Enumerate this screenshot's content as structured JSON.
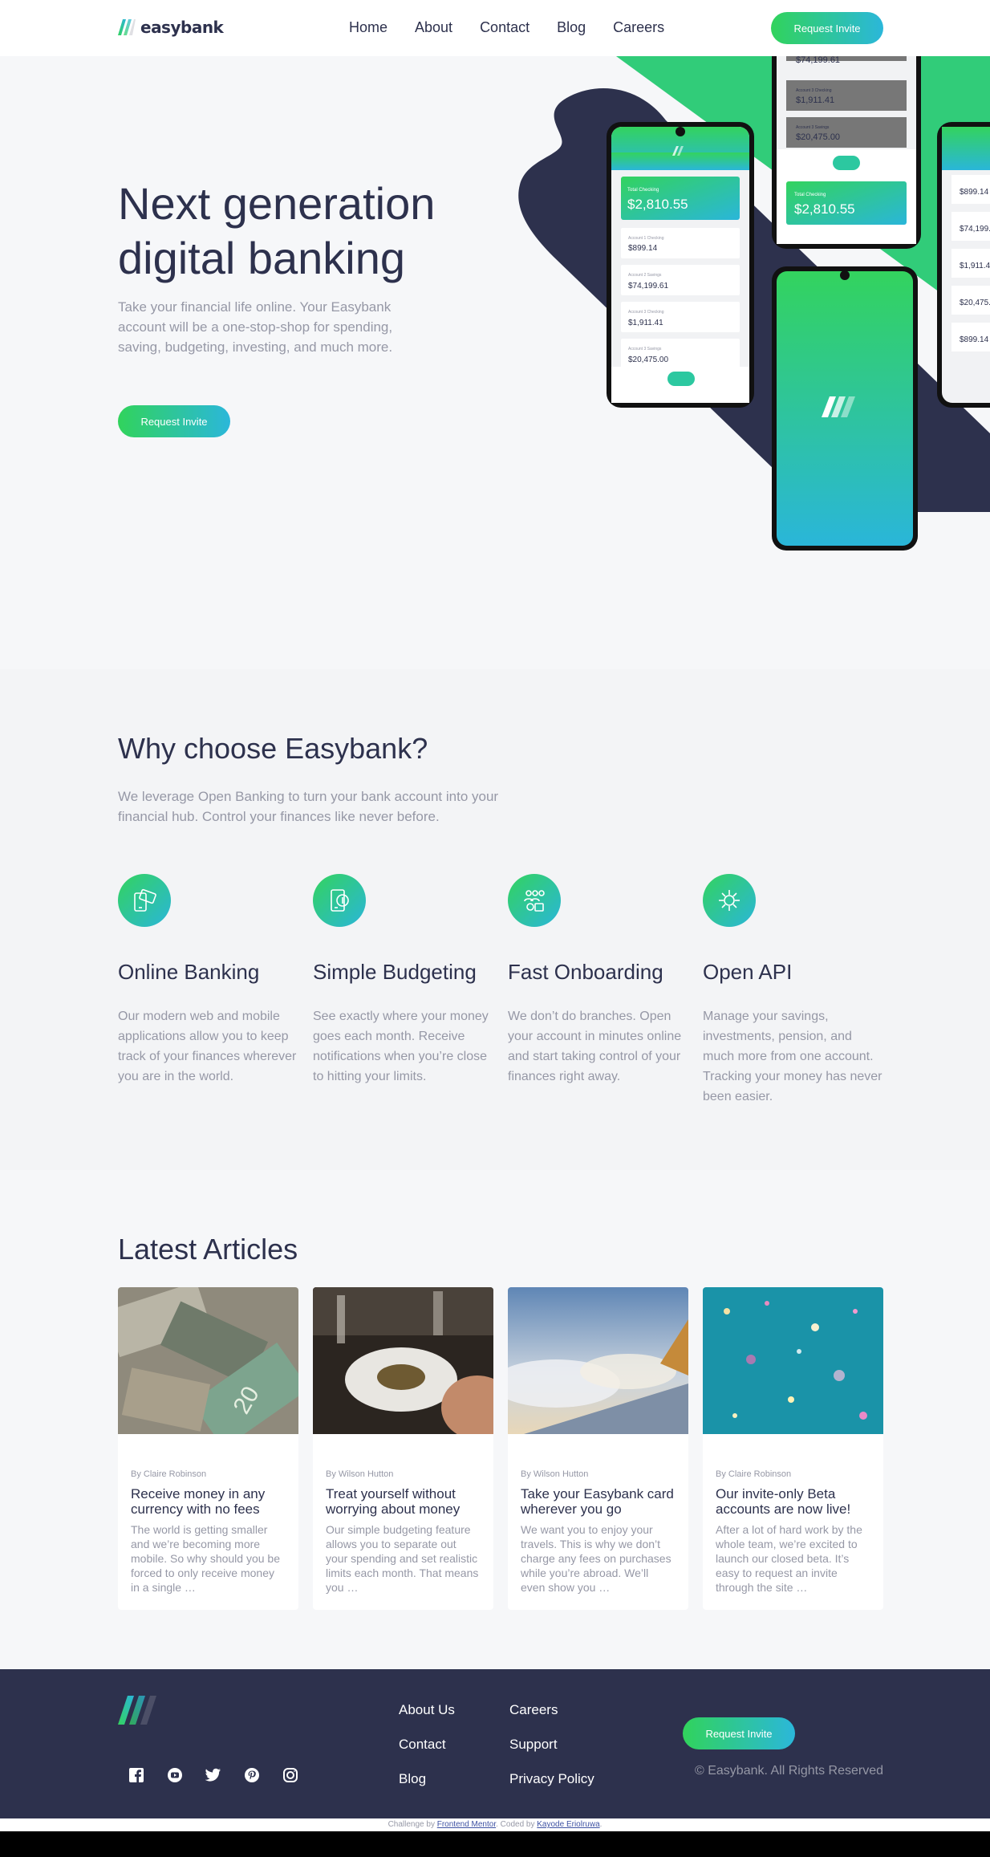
{
  "brand": {
    "name": "easybank"
  },
  "nav": {
    "items": [
      "Home",
      "About",
      "Contact",
      "Blog",
      "Careers"
    ],
    "cta": "Request Invite"
  },
  "hero": {
    "title": "Next generation digital banking",
    "text": "Take your financial life online. Your Easybank account will be a one-stop-shop for spending, saving, budgeting, investing, and much more.",
    "cta": "Request Invite",
    "mockups": {
      "total_checking_label": "Total Checking",
      "total_checking_amount": "$2,810.55",
      "accounts": [
        {
          "label": "Account 1 Checking",
          "amount": "$899.14"
        },
        {
          "label": "Account 2 Savings",
          "amount": "$74,199.61"
        },
        {
          "label": "Account 3 Checking",
          "amount": "$1,911.41"
        },
        {
          "label": "Account 3 Savings",
          "amount": "$20,475.00"
        }
      ]
    }
  },
  "why": {
    "title": "Why choose Easybank?",
    "text": "We leverage Open Banking to turn your bank account into your financial hub. Control your finances like never before.",
    "features": [
      {
        "icon": "online-banking-icon",
        "title": "Online Banking",
        "text": "Our modern web and mobile applications allow you to keep track of your finances wherever you are in the world."
      },
      {
        "icon": "budgeting-icon",
        "title": "Simple Budgeting",
        "text": "See exactly where your money goes each month. Receive notifications when you’re close to hitting your limits."
      },
      {
        "icon": "onboarding-icon",
        "title": "Fast Onboarding",
        "text": "We don’t do branches. Open your account in minutes online and start taking control of your finances right away."
      },
      {
        "icon": "api-icon",
        "title": "Open API",
        "text": "Manage your savings, investments, pension, and much more from one account. Tracking your money has never been easier."
      }
    ]
  },
  "articles": {
    "title": "Latest Articles",
    "items": [
      {
        "author": "By Claire Robinson",
        "title": "Receive money in any currency with no fees",
        "text": "The world is getting smaller and we’re becoming more mobile. So why should you be forced to only receive money in a single …"
      },
      {
        "author": "By Wilson Hutton",
        "title": "Treat yourself without worrying about money",
        "text": "Our simple budgeting feature allows you to separate out your spending and set realistic limits each month. That means you …"
      },
      {
        "author": "By Wilson Hutton",
        "title": "Take your Easybank card wherever you go",
        "text": "We want you to enjoy your travels. This is why we don’t charge any fees on purchases while you’re abroad. We’ll even show you …"
      },
      {
        "author": "By Claire Robinson",
        "title": "Our invite-only Beta accounts are now live!",
        "text": "After a lot of hard work by the whole team, we’re excited to launch our closed beta. It’s easy to request an invite through the site …"
      }
    ]
  },
  "footer": {
    "links_col1": [
      "About Us",
      "Contact",
      "Blog"
    ],
    "links_col2": [
      "Careers",
      "Support",
      "Privacy Policy"
    ],
    "cta": "Request Invite",
    "copyright": "© Easybank. All Rights Reserved",
    "social": [
      "facebook-icon",
      "youtube-icon",
      "twitter-icon",
      "pinterest-icon",
      "instagram-icon"
    ]
  },
  "attribution": {
    "prefix": "Challenge by",
    "challenge_link": "Frontend Mentor",
    "middle": ". Coded by",
    "author_link": "Kayode Eriolruwa",
    "suffix": "."
  },
  "colors": {
    "dark_blue": "#2d314d",
    "lime_green": "#31d35c",
    "bright_cyan": "#2bb7da",
    "grayish_blue": "#9698a6",
    "light_bg": "#f6f7f9"
  }
}
